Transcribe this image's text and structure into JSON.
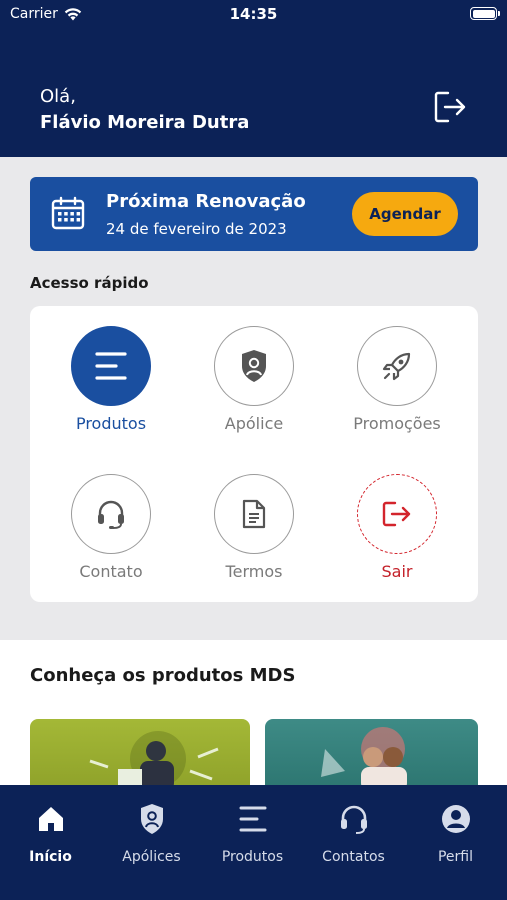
{
  "status_bar": {
    "carrier": "Carrier",
    "time": "14:35"
  },
  "header": {
    "greeting": "Olá,",
    "user_name": "Flávio Moreira Dutra"
  },
  "renewal": {
    "title": "Próxima Renovação",
    "date": "24 de fevereiro de 2023",
    "button_label": "Agendar"
  },
  "quick_access": {
    "title": "Acesso rápido",
    "items": [
      {
        "label": "Produtos",
        "icon": "menu-lines-icon",
        "state": "active"
      },
      {
        "label": "Apólice",
        "icon": "shield-person-icon",
        "state": "normal"
      },
      {
        "label": "Promoções",
        "icon": "rocket-icon",
        "state": "normal"
      },
      {
        "label": "Contato",
        "icon": "headset-icon",
        "state": "normal"
      },
      {
        "label": "Termos",
        "icon": "document-icon",
        "state": "normal"
      },
      {
        "label": "Sair",
        "icon": "logout-icon",
        "state": "danger"
      }
    ]
  },
  "products": {
    "title": "Conheça os produtos MDS"
  },
  "tabbar": {
    "items": [
      {
        "label": "Início",
        "icon": "home-icon",
        "active": true
      },
      {
        "label": "Apólices",
        "icon": "shield-person-icon",
        "active": false
      },
      {
        "label": "Produtos",
        "icon": "menu-lines-icon",
        "active": false
      },
      {
        "label": "Contatos",
        "icon": "headset-icon",
        "active": false
      },
      {
        "label": "Perfil",
        "icon": "user-circle-icon",
        "active": false
      }
    ]
  },
  "colors": {
    "navy": "#0c2257",
    "primary_blue": "#1a4fa0",
    "accent_orange": "#f6a90f",
    "danger_red": "#d3242c"
  }
}
